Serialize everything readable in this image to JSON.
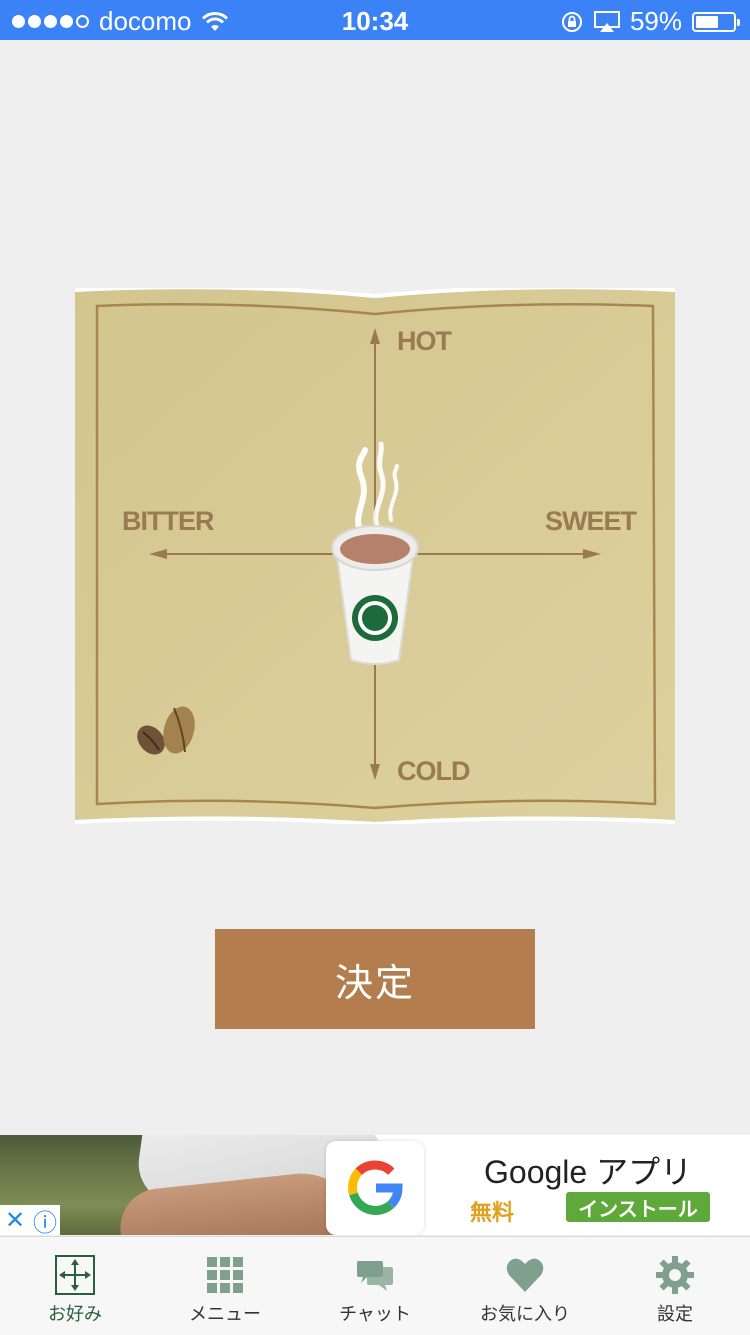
{
  "status_bar": {
    "carrier": "docomo",
    "time": "10:34",
    "battery": "59%"
  },
  "map": {
    "hot": "HOT",
    "cold": "COLD",
    "bitter": "BITTER",
    "sweet": "SWEET"
  },
  "decide_button": "決定",
  "ad": {
    "title": "Google アプリ",
    "free": "無料",
    "install": "インストール"
  },
  "tabs": [
    {
      "label": "お好み",
      "icon": "crosshair-arrows-icon",
      "active": true
    },
    {
      "label": "メニュー",
      "icon": "grid-icon"
    },
    {
      "label": "チャット",
      "icon": "chat-bubbles-icon"
    },
    {
      "label": "お気に入り",
      "icon": "heart-icon"
    },
    {
      "label": "設定",
      "icon": "gear-icon"
    }
  ],
  "colors": {
    "accent": "#b47d4e",
    "status_bar": "#3c82f7",
    "tab_icon": "#7fa08c",
    "active_tab": "#2a5e3e"
  }
}
